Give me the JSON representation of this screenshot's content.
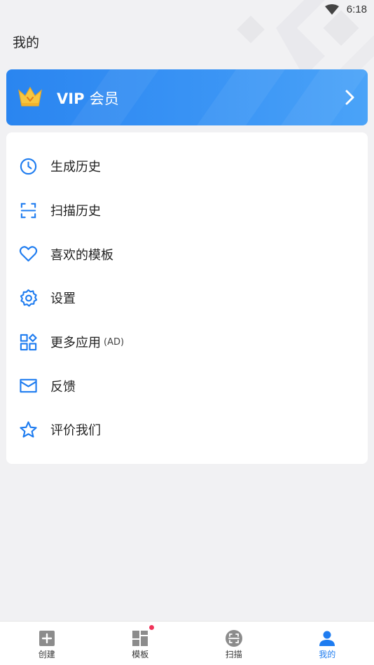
{
  "status_bar": {
    "time": "6:18"
  },
  "header": {
    "title": "我的"
  },
  "vip": {
    "label_latin": "VIP",
    "label_cn": "会员"
  },
  "menu": {
    "items": [
      {
        "label": "生成历史",
        "icon": "clock-icon"
      },
      {
        "label": "扫描历史",
        "icon": "scan-frame-icon"
      },
      {
        "label": "喜欢的模板",
        "icon": "heart-icon"
      },
      {
        "label": "设置",
        "icon": "gear-icon"
      },
      {
        "label": "更多应用",
        "suffix": "(AD)",
        "icon": "apps-grid-icon"
      },
      {
        "label": "反馈",
        "icon": "mail-icon"
      },
      {
        "label": "评价我们",
        "icon": "star-icon"
      }
    ]
  },
  "bottom_nav": {
    "tabs": [
      {
        "label": "创建",
        "icon": "plus-square-icon"
      },
      {
        "label": "模板",
        "icon": "template-icon",
        "badge": true
      },
      {
        "label": "扫描",
        "icon": "scan-icon"
      },
      {
        "label": "我的",
        "icon": "person-icon",
        "active": true
      }
    ]
  },
  "colors": {
    "accent": "#1e7cf0",
    "vip_gradient_start": "#2a85f0",
    "vip_gradient_end": "#4aa3f8",
    "badge": "#f0345a",
    "crown": "#f5c23a"
  }
}
